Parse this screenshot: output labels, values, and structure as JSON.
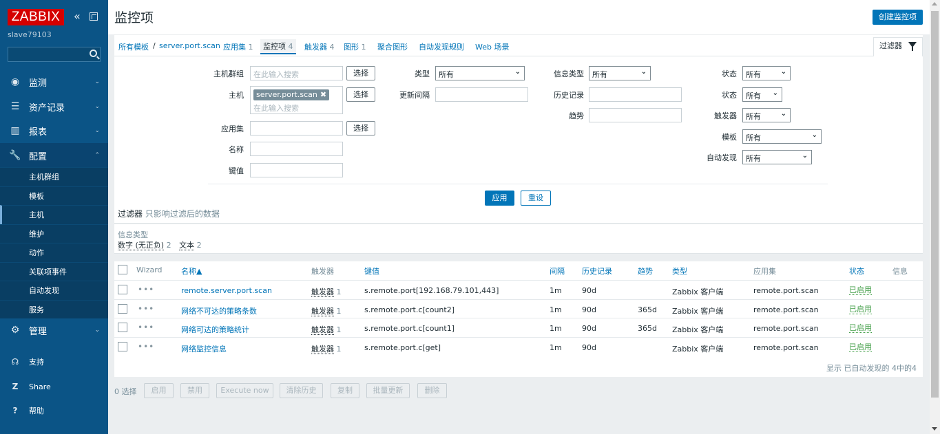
{
  "sidebar": {
    "logo": "ZABBIX",
    "server_name": "slave79103",
    "menu": [
      {
        "label": "监测",
        "icon": "eye-icon"
      },
      {
        "label": "资产记录",
        "icon": "list-icon"
      },
      {
        "label": "报表",
        "icon": "bar-chart-icon"
      },
      {
        "label": "配置",
        "icon": "wrench-icon"
      },
      {
        "label": "管理",
        "icon": "gear-icon"
      }
    ],
    "submenu": [
      "主机群组",
      "模板",
      "主机",
      "维护",
      "动作",
      "关联项事件",
      "自动发现",
      "服务"
    ],
    "bottom": [
      {
        "label": "支持",
        "icon": "headset-icon"
      },
      {
        "label": "Share",
        "icon": "zabbix-share-icon"
      },
      {
        "label": "帮助",
        "icon": "help-icon"
      }
    ]
  },
  "header": {
    "title": "监控项",
    "create_button": "创建监控项"
  },
  "tabs": {
    "all_templates": "所有模板",
    "sep": "/",
    "host": "server.port.scan",
    "applications": "应用集",
    "applications_count": "1",
    "items": "监控项",
    "items_count": "4",
    "triggers": "触发器",
    "triggers_count": "4",
    "graphs": "图形",
    "graphs_count": "1",
    "screens": "聚合图形",
    "discovery": "自动发现规则",
    "web": "Web 场景",
    "filter_tab": "过滤器"
  },
  "filter": {
    "host_group_label": "主机群组",
    "host_group_placeholder": "在此输入搜索",
    "select_label": "选择",
    "host_label": "主机",
    "host_tag": "server.port.scan",
    "host_placeholder": "在此输入搜索",
    "application_label": "应用集",
    "name_label": "名称",
    "key_label": "键值",
    "type_label": "类型",
    "type_value": "所有",
    "interval_label": "更新间隔",
    "info_type_label": "信息类型",
    "info_type_value": "所有",
    "history_label": "历史记录",
    "trends_label": "趋势",
    "status_label": "状态",
    "status_value": "所有",
    "state_label": "状态",
    "state_value": "所有",
    "triggers_label": "触发器",
    "triggers_value": "所有",
    "template_label": "模板",
    "template_value": "所有",
    "discovery_label": "自动发现",
    "discovery_value": "所有",
    "apply": "应用",
    "reset": "重设",
    "note_prefix": "过滤器",
    "note_rest": "只影响过滤后的数据"
  },
  "facets": {
    "title": "信息类型",
    "items": [
      {
        "label": "数字 (无正负)",
        "count": "2"
      },
      {
        "label": "文本",
        "count": "2"
      }
    ]
  },
  "table": {
    "headers": {
      "wizard": "Wizard",
      "name": "名称▲",
      "triggers": "触发器",
      "key": "键值",
      "interval": "间隔",
      "history": "历史记录",
      "trends": "趋势",
      "type": "类型",
      "applications": "应用集",
      "status": "状态",
      "info": "信息"
    },
    "rows": [
      {
        "name": "remote.server.port.scan",
        "triggers": "触发器",
        "trig_count": "1",
        "key": "s.remote.port[192.168.79.101,443]",
        "interval": "1m",
        "history": "90d",
        "trends": "",
        "type": "Zabbix 客户端",
        "application": "remote.port.scan",
        "status": "已启用"
      },
      {
        "name": "网络不可达的策略条数",
        "triggers": "触发器",
        "trig_count": "1",
        "key": "s.remote.port.c[count2]",
        "interval": "1m",
        "history": "90d",
        "trends": "365d",
        "type": "Zabbix 客户端",
        "application": "remote.port.scan",
        "status": "已启用"
      },
      {
        "name": "网络可达的策略统计",
        "triggers": "触发器",
        "trig_count": "1",
        "key": "s.remote.port.c[count1]",
        "interval": "1m",
        "history": "90d",
        "trends": "365d",
        "type": "Zabbix 客户端",
        "application": "remote.port.scan",
        "status": "已启用"
      },
      {
        "name": "网络监控信息",
        "triggers": "触发器",
        "trig_count": "1",
        "key": "s.remote.port.c[get]",
        "interval": "1m",
        "history": "90d",
        "trends": "",
        "type": "Zabbix 客户端",
        "application": "remote.port.scan",
        "status": "已启用"
      }
    ],
    "footer": "显示 已自动发现的 4中的4"
  },
  "actions": {
    "selected": "0 选择",
    "enable": "启用",
    "disable": "禁用",
    "execute_now": "Execute now",
    "clear_history": "清除历史",
    "copy": "复制",
    "mass_update": "批量更新",
    "delete": "删除"
  },
  "colors": {
    "sidebar_bg": "#0b5486",
    "logo_bg": "#d40000",
    "link": "#0275b8",
    "enabled": "#429e47"
  }
}
